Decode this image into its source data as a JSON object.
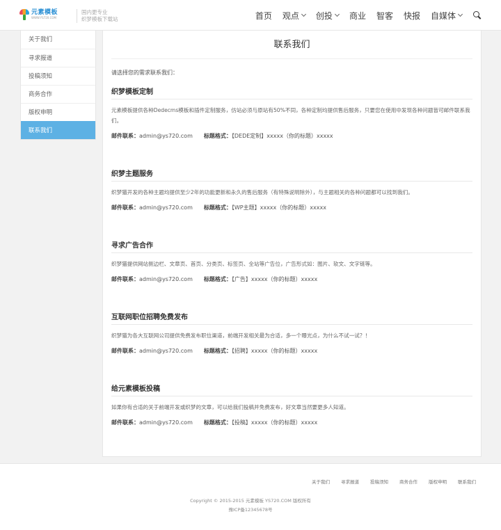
{
  "header": {
    "logo_name": "元素模板",
    "logo_sub": "WWW.YS720.COM",
    "slogan_line1": "国内更专业",
    "slogan_line2": "织梦模板下载站",
    "nav": [
      {
        "label": "首页",
        "dropdown": false
      },
      {
        "label": "观点",
        "dropdown": true
      },
      {
        "label": "创投",
        "dropdown": true
      },
      {
        "label": "商业",
        "dropdown": false
      },
      {
        "label": "智客",
        "dropdown": false
      },
      {
        "label": "快报",
        "dropdown": false
      },
      {
        "label": "自媒体",
        "dropdown": true
      }
    ]
  },
  "sidebar": {
    "items": [
      {
        "label": "关于我们"
      },
      {
        "label": "寻求报道"
      },
      {
        "label": "投稿须知"
      },
      {
        "label": "商务合作"
      },
      {
        "label": "版权申明"
      },
      {
        "label": "联系我们"
      }
    ],
    "active_index": 5
  },
  "main": {
    "title": "联系我们",
    "intro": "请选择您的需求联系我们：",
    "contact_label": "邮件联系：",
    "format_label": "标题格式：",
    "sections": [
      {
        "title": "织梦模板定制",
        "desc": "元素模板提供各种Dedecms模板和插件定制服务，仿站必须与原站有50%不同，各种定制均提供售后服务，只要您在使用中发现各种问题皆可邮件联系我们。",
        "email": "admin@ys720.com",
        "format": "【DEDE定制】xxxxx（你的标题）xxxxx"
      },
      {
        "title": "织梦主题服务",
        "desc": "织梦猫开发的各种主题均提供至少2年的功能更新和永久的售后服务（有特殊说明除外），与主题相关的各种问题都可以找到我们。",
        "email": "admin@ys720.com",
        "format": "【WP主题】xxxxx（你的标题）xxxxx"
      },
      {
        "title": "寻求广告合作",
        "desc": "织梦猫提供网站侧边栏、文章页、首页、分类页、标签页、全站等广告位，广告形式如：图片、软文、文字链等。",
        "email": "admin@ys720.com",
        "format": "【广告】xxxxx（你的标题）xxxxx"
      },
      {
        "title": "互联网职位招聘免费发布",
        "desc": "织梦猫为各大互联网公司提供免费发布职位渠道，前端开发相关最为合适，多一个曝光点，为什么不试一试？！",
        "email": "admin@ys720.com",
        "format": "【招聘】xxxxx（你的标题）xxxxx"
      },
      {
        "title": "给元素模板投稿",
        "desc": "如果你有合适的关于前端开发或织梦的文章，可以给我们投稿并免费发布，好文章当然要更多人知道。",
        "email": "admin@ys720.com",
        "format": "【投稿】xxxxx（你的标题）xxxxx"
      }
    ]
  },
  "footer": {
    "links": [
      "关于我们",
      "寻求报道",
      "投稿须知",
      "商务合作",
      "版权申明",
      "联系我们"
    ],
    "copyright": "Copyright © 2015-2015 元素模板 YS720.COM 版权所有",
    "icp": "豫ICP备12345678号"
  },
  "colors": {
    "accent": "#5db1e4",
    "logo_blue": "#2a8fd4"
  },
  "icons": {
    "search": "search-icon",
    "logo": "mushroom-logo-icon"
  }
}
